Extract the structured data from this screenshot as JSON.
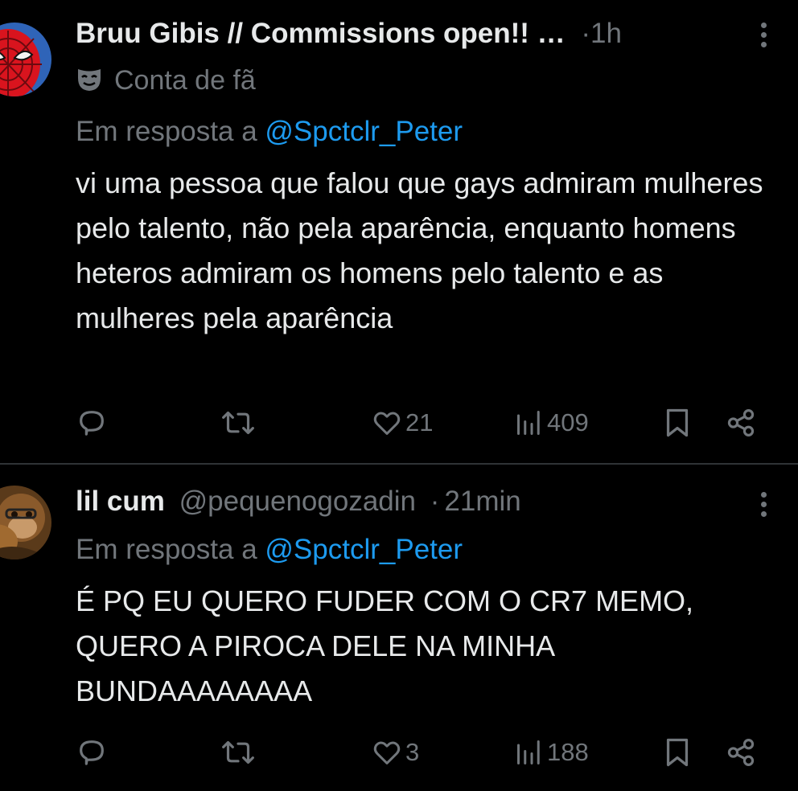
{
  "tweets": [
    {
      "display_name": "Bruu Gibis // Commissions open!! …",
      "handle": "",
      "time": "1h",
      "label_icon": "mask-icon",
      "label": "Conta de fã",
      "reply_prefix": "Em resposta a ",
      "reply_mention": "@Spctclr_Peter",
      "text": "vi uma pessoa que falou que gays admiram mulheres pelo talento, não pela aparência, enquanto homens heteros admiram os homens pelo talento e as mulheres pela aparência",
      "likes": "21",
      "views": "409"
    },
    {
      "display_name": "lil cum",
      "handle": "@pequenogozadin",
      "time": "21min",
      "label_icon": "",
      "label": "",
      "reply_prefix": "Em resposta a ",
      "reply_mention": "@Spctclr_Peter",
      "text": "É PQ EU QUERO FUDER COM O CR7 MEMO, QUERO A PIROCA DELE NA MINHA BUNDAAAAAAAA",
      "likes": "3",
      "views": "188"
    }
  ],
  "separator": "·",
  "colors": {
    "background": "#000000",
    "text": "#e7e9ea",
    "muted": "#71767b",
    "link": "#1d9bf0",
    "divider": "#2f3336"
  },
  "icons": [
    "reply-icon",
    "retweet-icon",
    "heart-icon",
    "views-icon",
    "bookmark-icon",
    "share-icon",
    "more-icon"
  ]
}
